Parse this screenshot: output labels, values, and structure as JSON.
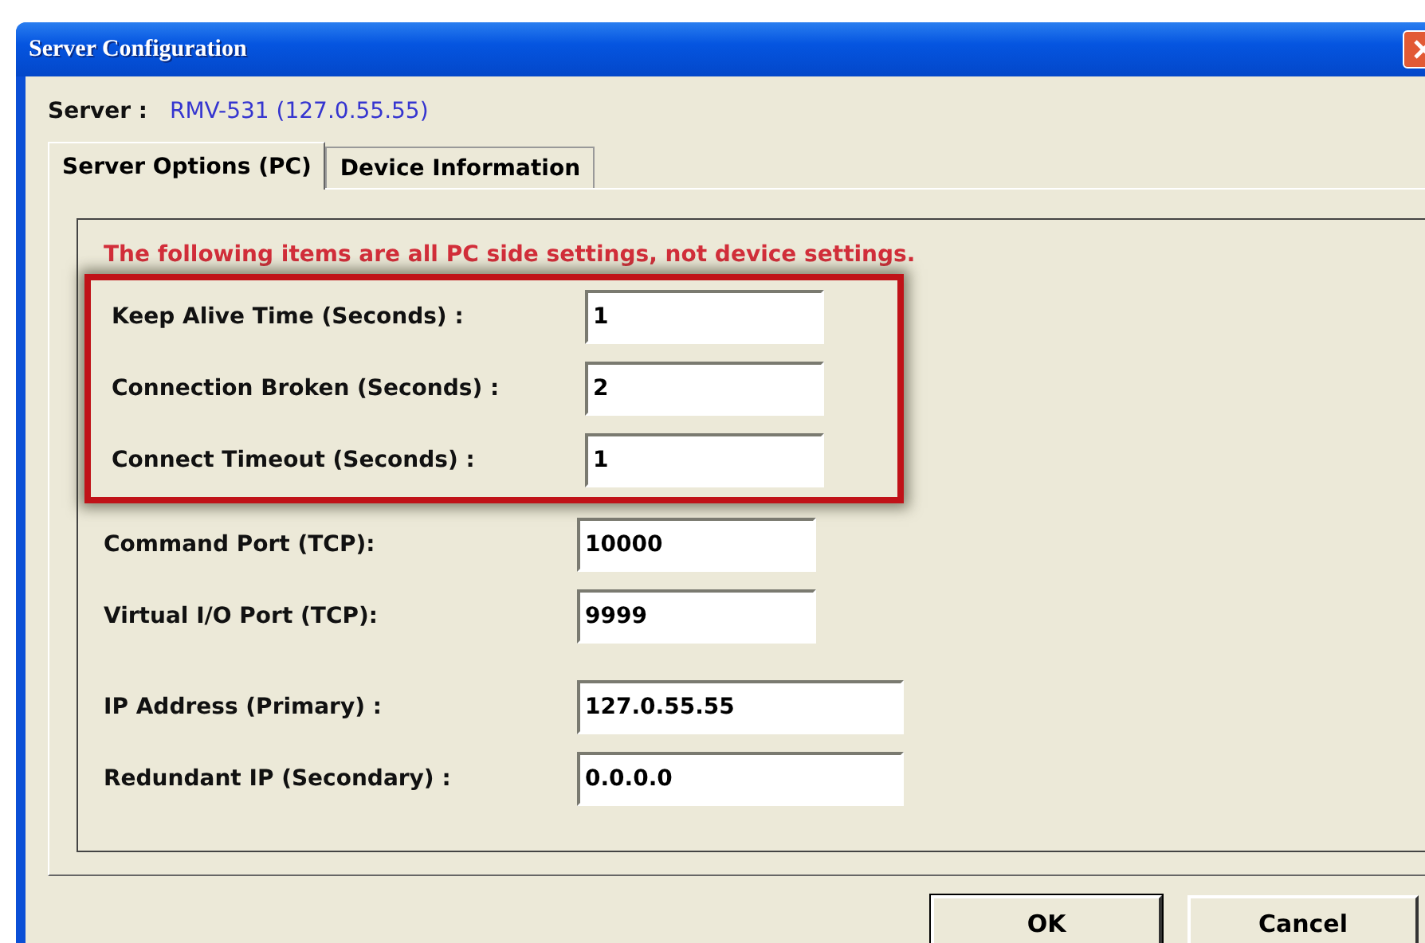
{
  "window": {
    "title": "Server Configuration"
  },
  "server": {
    "label": "Server :",
    "value": "RMV-531 (127.0.55.55)"
  },
  "tabs": [
    {
      "label": "Server Options (PC)",
      "selected": true
    },
    {
      "label": "Device Information",
      "selected": false
    }
  ],
  "notice": "The following items are all PC side settings, not device settings.",
  "field_groups": [
    {
      "highlighted": true,
      "fields": [
        {
          "label": "Keep Alive Time (Seconds) :",
          "value": "1",
          "kind": "number"
        },
        {
          "label": "Connection Broken (Seconds) :",
          "value": "2",
          "kind": "number"
        },
        {
          "label": "Connect Timeout (Seconds) :",
          "value": "1",
          "kind": "number"
        }
      ]
    },
    {
      "highlighted": false,
      "fields": [
        {
          "label": "Command Port (TCP):",
          "value": "10000",
          "kind": "number"
        },
        {
          "label": "Virtual I/O Port (TCP):",
          "value": "9999",
          "kind": "number"
        }
      ]
    },
    {
      "highlighted": false,
      "fields": [
        {
          "label": "IP Address (Primary) :",
          "value": "127.0.55.55",
          "kind": "ip"
        },
        {
          "label": "Redundant IP (Secondary) :",
          "value": "0.0.0.0",
          "kind": "ip"
        }
      ]
    }
  ],
  "buttons": [
    "OK",
    "Cancel"
  ]
}
